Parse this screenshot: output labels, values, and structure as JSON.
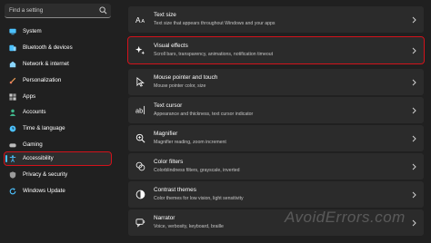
{
  "search": {
    "placeholder": "Find a setting",
    "icon": "search-icon"
  },
  "sidebar": {
    "items": [
      {
        "label": "System",
        "icon": "monitor-icon",
        "color": "#4cc2ff"
      },
      {
        "label": "Bluetooth & devices",
        "icon": "bluetooth-icon",
        "color": "#4cc2ff"
      },
      {
        "label": "Network & internet",
        "icon": "network-icon",
        "color": "#8ad6ff"
      },
      {
        "label": "Personalization",
        "icon": "brush-icon",
        "color": "#f4a259"
      },
      {
        "label": "Apps",
        "icon": "apps-icon",
        "color": "#c8c8c8"
      },
      {
        "label": "Accounts",
        "icon": "person-icon",
        "color": "#3fb68b"
      },
      {
        "label": "Time & language",
        "icon": "globe-clock-icon",
        "color": "#4cc2ff"
      },
      {
        "label": "Gaming",
        "icon": "controller-icon",
        "color": "#bdbdbd"
      },
      {
        "label": "Accessibility",
        "icon": "accessibility-icon",
        "color": "#4cc2ff",
        "active": true
      },
      {
        "label": "Privacy & security",
        "icon": "shield-icon",
        "color": "#9b9b9b"
      },
      {
        "label": "Windows Update",
        "icon": "refresh-icon",
        "color": "#4cc2ff"
      }
    ]
  },
  "main": {
    "cards": [
      {
        "title": "Text size",
        "subtitle": "Text size that appears throughout Windows and your apps",
        "icon": "text-size-icon"
      },
      {
        "title": "Visual effects",
        "subtitle": "Scroll bars, transparency, animations, notification timeout",
        "icon": "sparkle-icon",
        "highlight": true
      },
      {
        "title": "Mouse pointer and touch",
        "subtitle": "Mouse pointer color, size",
        "icon": "mouse-pointer-icon"
      },
      {
        "title": "Text cursor",
        "subtitle": "Appearance and thickness, text cursor indicator",
        "icon": "text-cursor-icon"
      },
      {
        "title": "Magnifier",
        "subtitle": "Magnifier reading, zoom increment",
        "icon": "magnifier-icon"
      },
      {
        "title": "Color filters",
        "subtitle": "Colorblindness filters, grayscale, inverted",
        "icon": "color-filter-icon"
      },
      {
        "title": "Contrast themes",
        "subtitle": "Color themes for low vision, light sensitivity",
        "icon": "contrast-icon"
      },
      {
        "title": "Narrator",
        "subtitle": "Voice, verbosity, keyboard, braille",
        "icon": "narrator-icon"
      }
    ]
  },
  "watermark": "AvoidErrors.com",
  "colors": {
    "highlight": "#d3121b",
    "accent": "#4cc2ff",
    "background": "#202020",
    "card": "#2b2b2b"
  }
}
